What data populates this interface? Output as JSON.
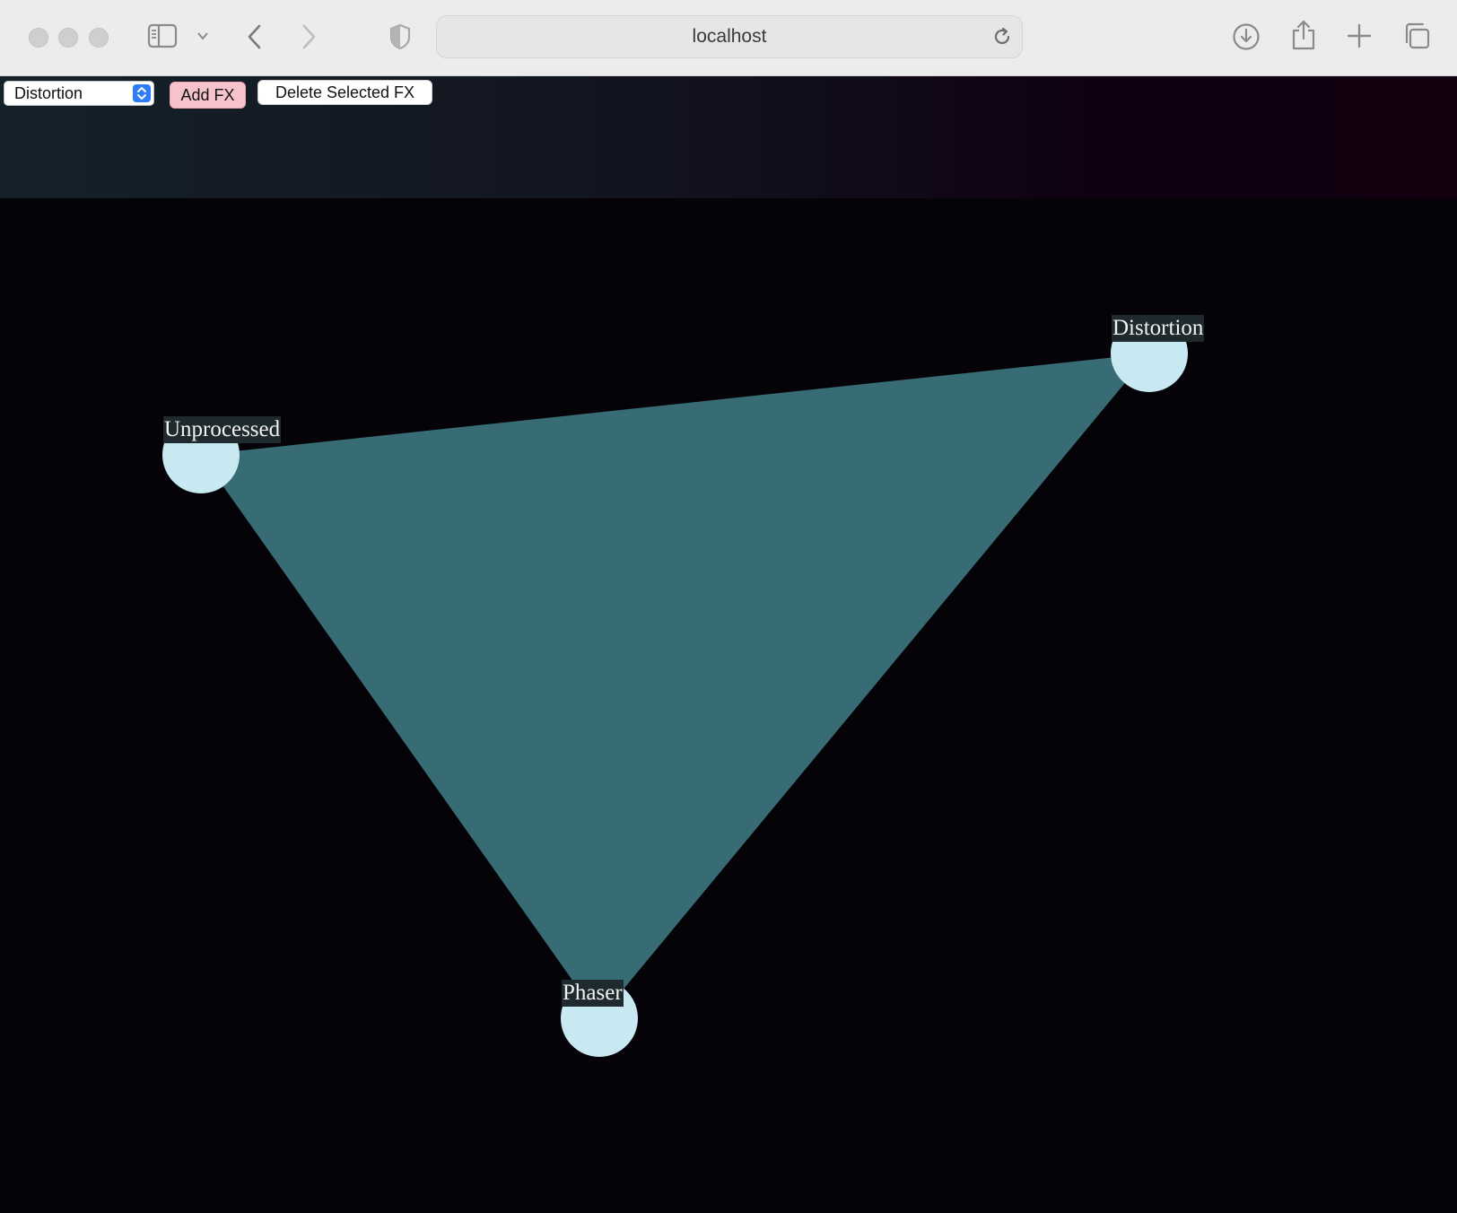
{
  "browser": {
    "url": "localhost"
  },
  "controls": {
    "fx_select_value": "Distortion",
    "add_label": "Add FX",
    "delete_label": "Delete Selected FX"
  },
  "graph": {
    "fill_color": "#376c74",
    "node_color": "#c8e9f1",
    "nodes": [
      {
        "id": "unprocessed",
        "label": "Unprocessed"
      },
      {
        "id": "distortion",
        "label": "Distortion"
      },
      {
        "id": "phaser",
        "label": "Phaser"
      }
    ]
  },
  "colors": {
    "add_button": "#f6c3cd",
    "select_accent": "#2f7bf5"
  }
}
